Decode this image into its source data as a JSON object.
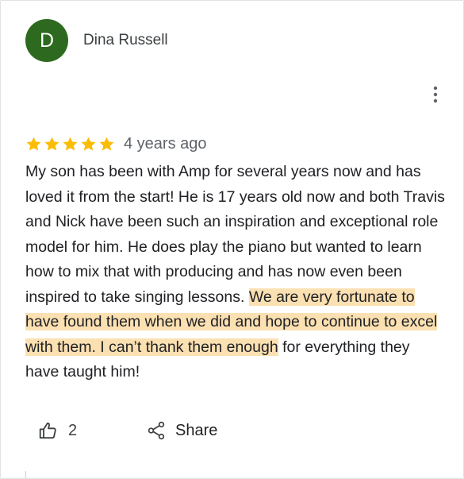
{
  "review": {
    "author": {
      "initial": "D",
      "name": "Dina Russell",
      "avatar_color": "#2d6a1f"
    },
    "rating": 5,
    "max_rating": 5,
    "star_color": "#fbbc04",
    "time": "4 years ago",
    "text_plain": "My son has been with Amp for several years now and has loved it from the start! He is 17 years old now and both Travis and Nick have been such an inspiration and exceptional role model for him. He does play the piano but wanted to learn how to mix that with producing and has now even been inspired to take singing lessons. ",
    "text_highlight": "We are very fortunate to have found them when we did and hope to continue to excel with them. I can’t thank them enough",
    "text_end": " for everything they have taught him!",
    "highlight_color": "#fbe0b2",
    "likes": "2",
    "share_label": "Share",
    "menu_icon": "more-vert-icon"
  }
}
